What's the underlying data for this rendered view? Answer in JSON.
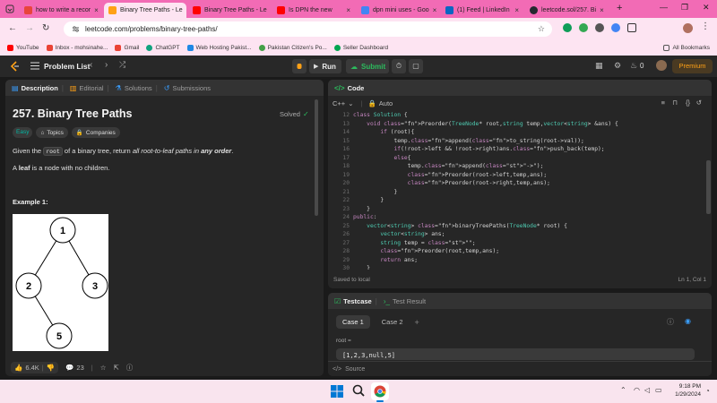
{
  "browser": {
    "tabs": [
      {
        "label": "how to write a recor",
        "favicon_color": "#e8453c"
      },
      {
        "label": "Binary Tree Paths - Le",
        "favicon_color": "#ffa116",
        "active": true
      },
      {
        "label": "Binary Tree Paths - Le",
        "favicon_color": "#ff0000"
      },
      {
        "label": "Is DPN the new",
        "favicon_color": "#ff0000"
      },
      {
        "label": "dpn mini uses - Goo",
        "favicon_color": "#4285f4"
      },
      {
        "label": "(1) Feed | LinkedIn",
        "favicon_color": "#0a66c2"
      },
      {
        "label": "leetcode.sol/257. Bi",
        "favicon_color": "#24292f"
      }
    ],
    "new_tab": "+",
    "url": "leetcode.com/problems/binary-tree-paths/",
    "bookmarks": [
      {
        "label": "YouTube",
        "color": "#ff0000"
      },
      {
        "label": "Inbox - mohsinahe...",
        "color": "#ea4335"
      },
      {
        "label": "Gmail",
        "color": "#ea4335"
      },
      {
        "label": "ChatGPT",
        "color": "#10a37f"
      },
      {
        "label": "Web Hosting Pakist...",
        "color": "#1e88e5"
      },
      {
        "label": "Pakistan Citizen's Po...",
        "color": "#43a047"
      },
      {
        "label": "Seller Dashboard",
        "color": "#00a651"
      }
    ],
    "all_bookmarks": "All Bookmarks"
  },
  "leetcode": {
    "problem_list": "Problem List",
    "run": "Run",
    "submit": "Submit",
    "streak": "0",
    "premium": "Premium"
  },
  "left": {
    "tabs": [
      "Description",
      "Editorial",
      "Solutions",
      "Submissions"
    ],
    "title": "257. Binary Tree Paths",
    "status": "Solved",
    "tags": [
      "Easy",
      "Topics",
      "Companies"
    ],
    "desc_parts": [
      "Given the ",
      "root",
      " of a binary tree, return ",
      "all root-to-leaf paths in ",
      "any order",
      "."
    ],
    "leaf_parts": [
      "A ",
      "leaf",
      " is a node with no children."
    ],
    "example_title": "Example 1:",
    "tree_nodes": [
      "1",
      "2",
      "3",
      "5"
    ],
    "likes": "6.4K",
    "comments": "23"
  },
  "code": {
    "header": "Code",
    "language": "C++",
    "mode": "Auto",
    "saved": "Saved to local",
    "cursor": "Ln 1, Col 1",
    "lines": [
      {
        "n": "12",
        "t": "class Solution {"
      },
      {
        "n": "13",
        "t": "    void Preorder(TreeNode* root,string temp,vector<string> &ans) {"
      },
      {
        "n": "14",
        "t": "        if (root){"
      },
      {
        "n": "15",
        "t": "            temp.append(to_string(root->val));"
      },
      {
        "n": "16",
        "t": "            if(!root->left && !root->right)ans.push_back(temp);"
      },
      {
        "n": "17",
        "t": "            else{"
      },
      {
        "n": "18",
        "t": "                temp.append(\"->\");"
      },
      {
        "n": "19",
        "t": "                Preorder(root->left,temp,ans);"
      },
      {
        "n": "20",
        "t": "                Preorder(root->right,temp,ans);"
      },
      {
        "n": "21",
        "t": "            }"
      },
      {
        "n": "22",
        "t": "        }"
      },
      {
        "n": "23",
        "t": "    }"
      },
      {
        "n": "24",
        "t": "public:"
      },
      {
        "n": "25",
        "t": "    vector<string> binaryTreePaths(TreeNode* root) {"
      },
      {
        "n": "26",
        "t": "        vector<string> ans;"
      },
      {
        "n": "27",
        "t": "        string temp = \"\";"
      },
      {
        "n": "28",
        "t": "        Preorder(root,temp,ans);"
      },
      {
        "n": "29",
        "t": "        return ans;"
      },
      {
        "n": "30",
        "t": "    }"
      }
    ]
  },
  "testcase": {
    "tabs": [
      "Testcase",
      "Test Result"
    ],
    "cases": [
      "Case 1",
      "Case 2"
    ],
    "add": "+",
    "var_label": "root =",
    "value": "[1,2,3,null,5]",
    "source": "Source"
  },
  "taskbar": {
    "time": "9:18 PM",
    "date": "1/29/2024"
  }
}
